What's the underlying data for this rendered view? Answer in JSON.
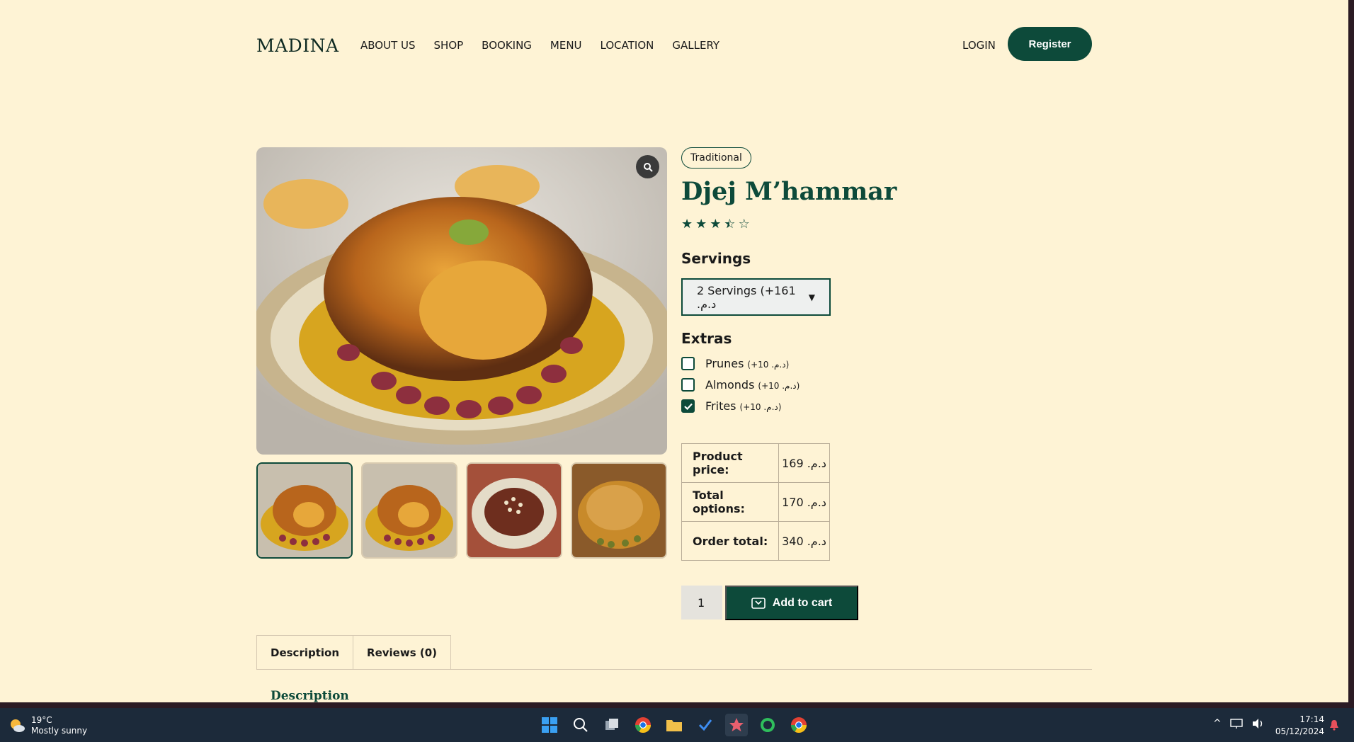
{
  "header": {
    "logo": "MADINA",
    "nav": [
      "ABOUT US",
      "SHOP",
      "BOOKING",
      "MENU",
      "LOCATION",
      "GALLERY"
    ],
    "login": "LOGIN",
    "register": "Register"
  },
  "product": {
    "badge": "Traditional",
    "title": "Djej M’hammar",
    "rating": 3.5,
    "rating_max": 5,
    "servings_heading": "Servings",
    "servings_selected": "2 Servings (+161 .د.م",
    "extras_heading": "Extras",
    "extras": [
      {
        "label": "Prunes",
        "price": "(+10 .د.م)",
        "checked": false
      },
      {
        "label": "Almonds",
        "price": "(+10 .د.م)",
        "checked": false
      },
      {
        "label": "Frites",
        "price": "(+10 .د.م)",
        "checked": true
      }
    ],
    "totals": [
      {
        "label": "Product price:",
        "value": "169 .د.م"
      },
      {
        "label": "Total options:",
        "value": "170 .د.م"
      },
      {
        "label": "Order total:",
        "value": "340 .د.م"
      }
    ],
    "quantity": "1",
    "add_to_cart": "Add to cart"
  },
  "tabs": {
    "items": [
      "Description",
      "Reviews (0)"
    ],
    "content_heading": "Description"
  },
  "taskbar": {
    "temperature": "19°C",
    "weather": "Mostly sunny",
    "time": "17:14",
    "date": "05/12/2024"
  },
  "colors": {
    "accent": "#0d4a3a",
    "page_bg": "#fef3d5",
    "taskbar_bg": "#1c2a3a"
  }
}
